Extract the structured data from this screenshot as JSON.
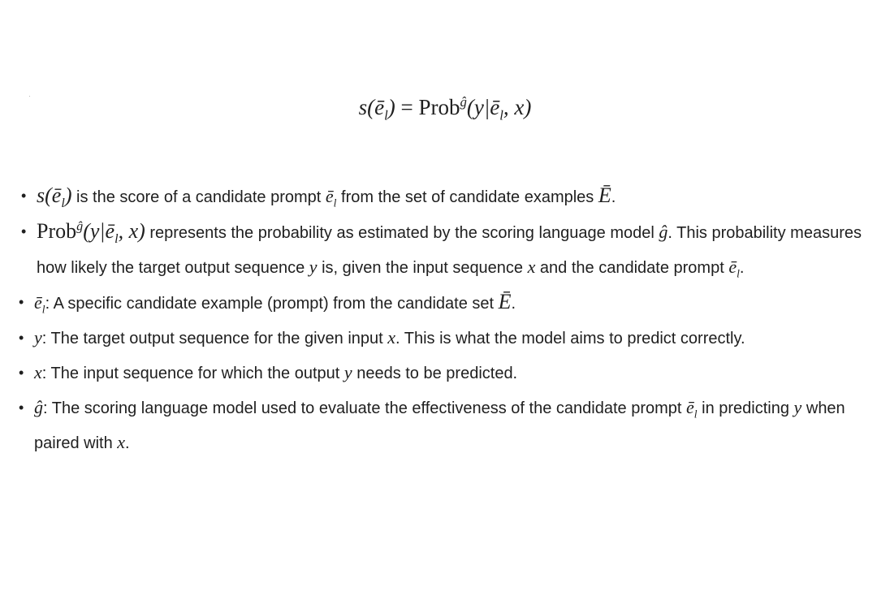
{
  "equation": {
    "lhs": "s(ē",
    "sub_l": "l",
    "lhs_close": ")",
    "equals": " = ",
    "prob": "Prob",
    "g_hat": "ĝ",
    "rhs_a": "(y|ē",
    "rhs_b": ", x)"
  },
  "bullets": [
    {
      "math_a": "s(ē",
      "sub": "l",
      "math_b": ")",
      "text_a": " is the score of a candidate prompt ",
      "math_c": "ē",
      "sub2": "l",
      "text_b": " from the set of candidate examples ",
      "math_d": "Ē",
      "text_c": "."
    },
    {
      "prob": "Prob",
      "g_hat": "ĝ",
      "math_a": "(y|ē",
      "sub": "l",
      "math_b": ", x)",
      "text_a": " represents the probability as estimated by the scoring language model ",
      "g_hat2": "ĝ",
      "text_b": ". This probability measures how likely the target output sequence ",
      "y": "y",
      "text_c": " is, given the input sequence ",
      "x": "x",
      "text_d": " and the candidate prompt ",
      "math_c": "ē",
      "sub2": "l",
      "text_e": "."
    },
    {
      "math_a": "ē",
      "sub": "l",
      "text_a": ": A specific candidate example (prompt) from the candidate set ",
      "math_b": "Ē",
      "text_b": "."
    },
    {
      "math_a": "y",
      "text_a": ": The target output sequence for the given input ",
      "math_b": "x",
      "text_b": ". This is what the model aims to predict correctly."
    },
    {
      "math_a": "x",
      "text_a": ": The input sequence for which the output ",
      "math_b": "y",
      "text_b": " needs to be predicted."
    },
    {
      "math_a": "ĝ",
      "text_a": ": The scoring language model used to evaluate the effectiveness of the candidate prompt ",
      "math_b": "ē",
      "sub": "l",
      "text_b": " in predicting ",
      "y": "y",
      "text_c": " when paired with ",
      "x": "x",
      "text_d": "."
    }
  ],
  "bullet_glyph": "•"
}
